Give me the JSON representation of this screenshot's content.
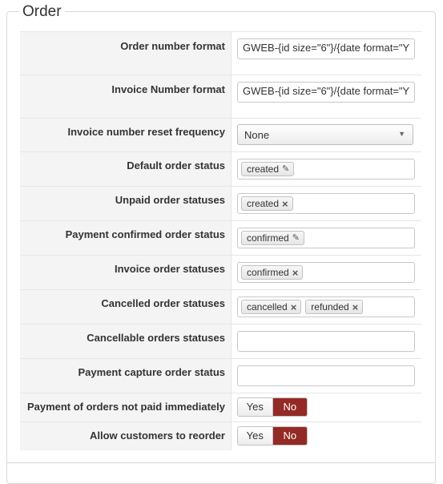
{
  "section": {
    "title": "Order"
  },
  "fields": {
    "order_number_format": {
      "label": "Order number format",
      "value": "GWEB-{id size=\"6\"}/{date format=\"Y"
    },
    "invoice_number_format": {
      "label": "Invoice Number format",
      "value": "GWEB-{id size=\"6\"}/{date format=\"Y"
    },
    "invoice_reset": {
      "label": "Invoice number reset frequency",
      "value": "None"
    },
    "default_order_status": {
      "label": "Default order status",
      "tags": [
        "created"
      ]
    },
    "unpaid_statuses": {
      "label": "Unpaid order statuses",
      "tags": [
        "created"
      ]
    },
    "payment_confirmed": {
      "label": "Payment confirmed order status",
      "tags": [
        "confirmed"
      ]
    },
    "invoice_statuses": {
      "label": "Invoice order statuses",
      "tags": [
        "confirmed"
      ]
    },
    "cancelled_statuses": {
      "label": "Cancelled order statuses",
      "tags": [
        "cancelled",
        "refunded"
      ]
    },
    "cancellable_statuses": {
      "label": "Cancellable orders statuses",
      "value": ""
    },
    "payment_capture": {
      "label": "Payment capture order status",
      "value": ""
    },
    "not_paid_immediately": {
      "label": "Payment of orders not paid immediately",
      "yes": "Yes",
      "no": "No",
      "selected": "No"
    },
    "allow_reorder": {
      "label": "Allow customers to reorder",
      "yes": "Yes",
      "no": "No",
      "selected": "No"
    }
  },
  "icons": {
    "remove": "close-icon",
    "edit": "pencil-icon",
    "dropdown": "caret-down-icon"
  },
  "colors": {
    "toggle_active": "#942a25",
    "label_bg": "#f4f4f4"
  }
}
